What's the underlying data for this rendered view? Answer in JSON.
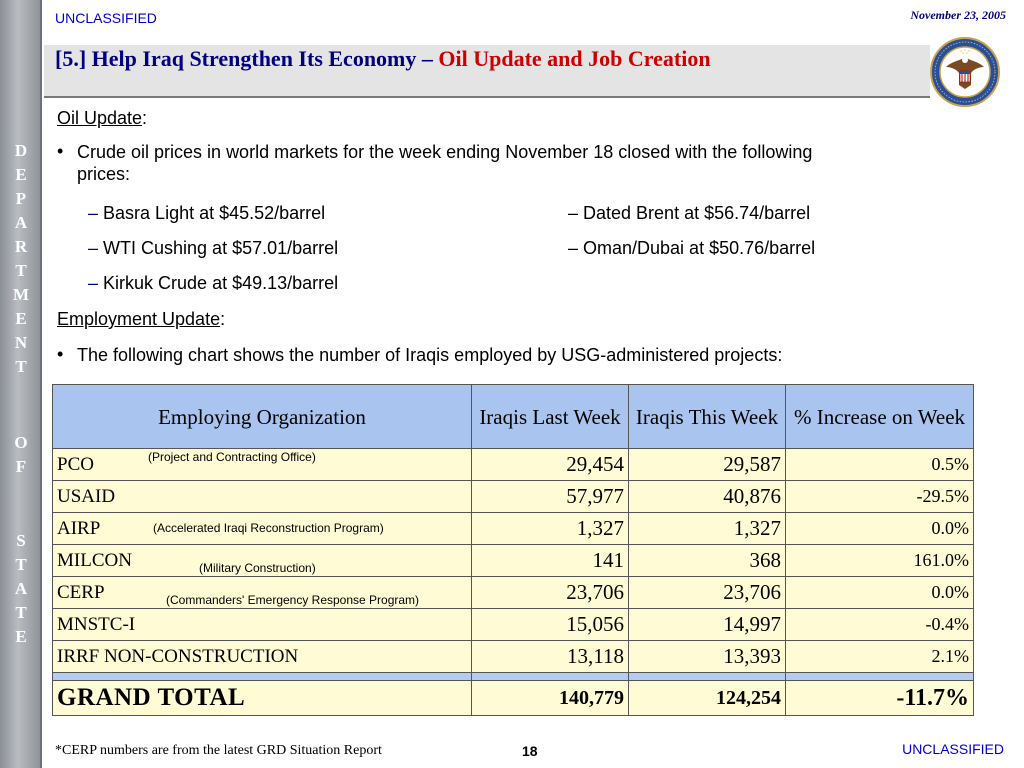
{
  "header": {
    "classification_top": "UNCLASSIFIED",
    "date": "November 23, 2005",
    "title_main": "[5.] Help Iraq Strengthen Its Economy – ",
    "title_highlight": "Oil Update and Job Creation"
  },
  "sidebar": {
    "letters": [
      "D",
      "E",
      "P",
      "A",
      "R",
      "T",
      "M",
      "E",
      "N",
      "T",
      "O",
      "F",
      "S",
      "T",
      "A",
      "T",
      "E"
    ]
  },
  "oil": {
    "heading": "Oil Update",
    "heading_colon": ":",
    "bullet_line1": "Crude oil prices in world markets for the week ending November 18 closed with the following",
    "bullet_line2": "prices:",
    "prices": [
      {
        "dash": "–",
        "label": "Basra Light at $45.52/barrel"
      },
      {
        "dash": "–",
        "label": "WTI Cushing at $57.01/barrel"
      },
      {
        "dash": "–",
        "label": "Kirkuk Crude at $49.13/barrel"
      }
    ],
    "prices_right": [
      "– Dated Brent at $56.74/barrel",
      "– Oman/Dubai at $50.76/barrel"
    ]
  },
  "employment": {
    "heading": "Employment Update",
    "heading_colon": ":",
    "bullet": "The following chart shows the number of Iraqis employed by USG-administered projects:"
  },
  "bullet_glyph": "•",
  "table": {
    "headers": [
      "Employing Organization",
      "Iraqis Last Week",
      "Iraqis This Week",
      "% Increase on Week"
    ],
    "rows": [
      {
        "org": "PCO",
        "note": "(Project and Contracting Office)",
        "last": "29,454",
        "this": "29,587",
        "pct": "0.5%"
      },
      {
        "org": "USAID",
        "note": "",
        "last": "57,977",
        "this": "40,876",
        "pct": "-29.5%"
      },
      {
        "org": "AIRP",
        "note": "(Accelerated Iraqi Reconstruction Program)",
        "last": "1,327",
        "this": "1,327",
        "pct": "0.0%"
      },
      {
        "org": "MILCON",
        "note": "(Military Construction)",
        "last": "141",
        "this": "368",
        "pct": "161.0%"
      },
      {
        "org": "CERP",
        "note": "(Commanders' Emergency Response Program)",
        "last": "23,706",
        "this": "23,706",
        "pct": "0.0%"
      },
      {
        "org": "MNSTC-I",
        "note": "",
        "last": "15,056",
        "this": "14,997",
        "pct": "-0.4%"
      },
      {
        "org": "IRRF NON-CONSTRUCTION",
        "note": "",
        "last": "13,118",
        "this": "13,393",
        "pct": "2.1%"
      }
    ],
    "total": {
      "org": "GRAND TOTAL",
      "last": "140,779",
      "this": "124,254",
      "pct": "-11.7%"
    }
  },
  "footer": {
    "footnote": "*CERP numbers are from the latest GRD Situation Report",
    "page_number": "18",
    "classification_bottom": "UNCLASSIFIED"
  },
  "colors": {
    "title_blue": "#000080",
    "title_red": "#cc0000",
    "classification_blue": "#0000cc",
    "header_fill": "#a9c4ee",
    "cell_fill": "#fffbd4"
  },
  "icons": {
    "seal": "department-of-state-seal-icon"
  }
}
